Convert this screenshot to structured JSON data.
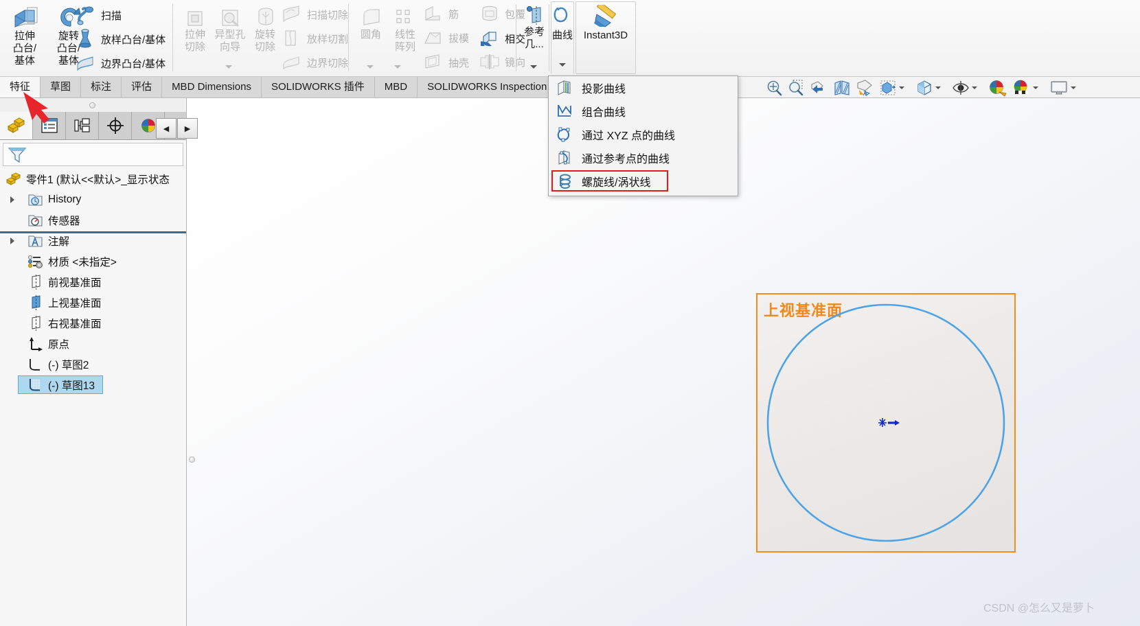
{
  "app": {
    "name": "SOLIDWORKS",
    "accent_orange": "#f2871a",
    "accent_blue": "#4da3e8",
    "highlight_red": "#e8181c",
    "selection_blue": "#add8f0"
  },
  "ribbon": {
    "groups": [
      {
        "id": "boss-base",
        "big_buttons": [
          {
            "name": "extrude-boss-base",
            "label_lines": [
              "拉伸",
              "凸台/",
              "基体"
            ],
            "icon": "extrude-boss-icon",
            "disabled": false
          },
          {
            "name": "revolve-boss-base",
            "label_lines": [
              "旋转",
              "凸台/",
              "基体"
            ],
            "icon": "revolve-boss-icon",
            "disabled": false
          }
        ],
        "row_buttons": [
          {
            "name": "swept-boss-base",
            "label": "扫描",
            "icon": "sweep-icon",
            "disabled": false
          },
          {
            "name": "lofted-boss-base",
            "label": "放样凸台/基体",
            "icon": "loft-icon",
            "disabled": false
          },
          {
            "name": "boundary-boss-base",
            "label": "边界凸台/基体",
            "icon": "boundary-icon",
            "disabled": false
          }
        ]
      },
      {
        "id": "cut",
        "big_buttons": [
          {
            "name": "extruded-cut",
            "label_lines": [
              "拉伸",
              "切除"
            ],
            "icon": "extrude-cut-icon",
            "disabled": true,
            "has_caret": true
          },
          {
            "name": "hole-wizard",
            "label_lines": [
              "异型孔",
              "向导"
            ],
            "icon": "hole-wizard-icon",
            "disabled": true
          },
          {
            "name": "revolved-cut",
            "label_lines": [
              "旋转",
              "切除"
            ],
            "icon": "revolve-cut-icon",
            "disabled": true
          }
        ],
        "row_buttons": [
          {
            "name": "swept-cut",
            "label": "扫描切除",
            "icon": "sweep-cut-icon",
            "disabled": true
          },
          {
            "name": "lofted-cut",
            "label": "放样切割",
            "icon": "loft-cut-icon",
            "disabled": true
          },
          {
            "name": "boundary-cut",
            "label": "边界切除",
            "icon": "boundary-cut-icon",
            "disabled": true
          }
        ]
      },
      {
        "id": "features",
        "big_buttons": [
          {
            "name": "fillet",
            "label_lines": [
              "圆角"
            ],
            "icon": "fillet-icon",
            "disabled": true,
            "has_caret": true
          },
          {
            "name": "linear-pattern",
            "label_lines": [
              "线性",
              "阵列"
            ],
            "icon": "linear-pattern-icon",
            "disabled": true,
            "has_caret": true
          }
        ],
        "row_buttons": [
          {
            "name": "rib",
            "label": "筋",
            "icon": "rib-icon",
            "disabled": true
          },
          {
            "name": "draft",
            "label": "拔模",
            "icon": "draft-icon",
            "disabled": true
          },
          {
            "name": "shell",
            "label": "抽壳",
            "icon": "shell-icon",
            "disabled": true
          },
          {
            "name": "wrap",
            "label": "包覆",
            "icon": "wrap-icon",
            "disabled": true
          },
          {
            "name": "intersect",
            "label": "相交",
            "icon": "intersect-icon",
            "disabled": false
          },
          {
            "name": "mirror",
            "label": "镜向",
            "icon": "mirror-icon",
            "disabled": true
          }
        ]
      },
      {
        "id": "reference",
        "big_buttons": [
          {
            "name": "reference-geometry",
            "label_lines": [
              "参考",
              "几..."
            ],
            "icon": "reference-geometry-icon",
            "disabled": false,
            "has_caret": true
          }
        ]
      },
      {
        "id": "curves",
        "big_buttons": [
          {
            "name": "curves",
            "label_lines": [
              "曲线"
            ],
            "icon": "curves-icon",
            "disabled": false,
            "has_caret": true,
            "active": true
          }
        ]
      },
      {
        "id": "instant3d",
        "buttons": [
          {
            "name": "instant3d",
            "label": "Instant3D",
            "icon": "instant3d-icon",
            "disabled": false
          }
        ]
      }
    ]
  },
  "tabs": {
    "items": [
      {
        "name": "tab-features",
        "label": "特征",
        "active": true
      },
      {
        "name": "tab-sketch",
        "label": "草图",
        "active": false
      },
      {
        "name": "tab-markup",
        "label": "标注",
        "active": false
      },
      {
        "name": "tab-evaluate",
        "label": "评估",
        "active": false
      },
      {
        "name": "tab-mbd-dimensions",
        "label": "MBD Dimensions",
        "active": false
      },
      {
        "name": "tab-solidworks-addins",
        "label": "SOLIDWORKS 插件",
        "active": false
      },
      {
        "name": "tab-mbd",
        "label": "MBD",
        "active": false
      },
      {
        "name": "tab-solidworks-inspection",
        "label": "SOLIDWORKS Inspection",
        "active": false
      }
    ]
  },
  "curves_menu": {
    "items": [
      {
        "name": "menu-item-projected-curve",
        "label": "投影曲线",
        "icon": "projected-curve-icon",
        "highlighted": false
      },
      {
        "name": "menu-item-composite-curve",
        "label": "组合曲线",
        "icon": "composite-curve-icon",
        "highlighted": false
      },
      {
        "name": "menu-item-curve-through-xyz",
        "label": "通过 XYZ 点的曲线",
        "icon": "curve-xyz-icon",
        "highlighted": false
      },
      {
        "name": "menu-item-curve-through-reference-points",
        "label": "通过参考点的曲线",
        "icon": "curve-ref-points-icon",
        "highlighted": false
      },
      {
        "name": "menu-item-helix-spiral",
        "label": "螺旋线/涡状线",
        "icon": "helix-spiral-icon",
        "highlighted": true
      }
    ]
  },
  "panel": {
    "tabs": [
      {
        "name": "pm-tab-feature-manager",
        "icon": "feature-manager-icon",
        "selected": true
      },
      {
        "name": "pm-tab-property-manager",
        "icon": "property-manager-icon",
        "selected": false
      },
      {
        "name": "pm-tab-configuration-manager",
        "icon": "configuration-manager-icon",
        "selected": false
      },
      {
        "name": "pm-tab-dimxpert-manager",
        "icon": "dimxpert-manager-icon",
        "selected": false
      },
      {
        "name": "pm-tab-display-manager",
        "icon": "display-manager-icon",
        "selected": false
      }
    ],
    "nav_prev": "◀",
    "nav_next": "▶",
    "filter_icon": "filter-icon"
  },
  "tree": {
    "root": {
      "name": "tree-root",
      "label": "零件1  (默认<<默认>_显示状态",
      "icon": "part-icon"
    },
    "items": [
      {
        "name": "tree-item-history",
        "label": "History",
        "icon": "history-folder-icon",
        "twisty": true,
        "indent": 40,
        "selected": false
      },
      {
        "name": "tree-item-sensors",
        "label": "传感器",
        "icon": "sensors-folder-icon",
        "twisty": false,
        "indent": 40,
        "selected": false
      },
      {
        "name": "tree-item-annotations",
        "label": "注解",
        "icon": "annotations-folder-icon",
        "twisty": true,
        "indent": 40,
        "selected": false
      },
      {
        "name": "tree-item-material",
        "label": "材质 <未指定>",
        "icon": "material-icon",
        "twisty": false,
        "indent": 40,
        "selected": false
      },
      {
        "name": "tree-item-front-plane",
        "label": "前视基准面",
        "icon": "plane-icon",
        "twisty": false,
        "indent": 40,
        "selected": false
      },
      {
        "name": "tree-item-top-plane",
        "label": "上视基准面",
        "icon": "plane-highlight-icon",
        "twisty": false,
        "indent": 40,
        "selected": false
      },
      {
        "name": "tree-item-right-plane",
        "label": "右视基准面",
        "icon": "plane-icon",
        "twisty": false,
        "indent": 40,
        "selected": false
      },
      {
        "name": "tree-item-origin",
        "label": "原点",
        "icon": "origin-icon",
        "twisty": false,
        "indent": 40,
        "selected": false
      },
      {
        "name": "tree-item-sketch2",
        "label": "(-) 草图2",
        "icon": "sketch-icon",
        "twisty": false,
        "indent": 40,
        "selected": false
      },
      {
        "name": "tree-item-sketch13",
        "label": "(-) 草图13",
        "icon": "sketch-active-icon",
        "twisty": false,
        "indent": 40,
        "selected": true
      }
    ]
  },
  "view_toolbar": {
    "items": [
      {
        "name": "zoom-to-fit-button",
        "icon": "zoom-to-fit-icon",
        "caret": false
      },
      {
        "name": "zoom-to-area-button",
        "icon": "zoom-to-area-icon",
        "caret": false
      },
      {
        "name": "previous-view-button",
        "icon": "previous-view-icon",
        "caret": false
      },
      {
        "name": "section-view-button",
        "icon": "section-view-icon",
        "caret": false
      },
      {
        "name": "view-orientation-button",
        "icon": "view-orientation-icon",
        "caret": false
      },
      {
        "name": "display-style-button",
        "icon": "display-style-icon",
        "caret": true
      },
      {
        "name": "apply-scene-button",
        "icon": "apply-scene-icon",
        "caret": true
      },
      {
        "name": "hide-show-items-button",
        "icon": "hide-show-eye-icon",
        "caret": true
      },
      {
        "name": "edit-appearance-button",
        "icon": "edit-appearance-icon",
        "caret": false
      },
      {
        "name": "apply-scene-2-button",
        "icon": "scene-checker-icon",
        "caret": true
      },
      {
        "name": "view-settings-button",
        "icon": "monitor-icon",
        "caret": true
      }
    ]
  },
  "canvas": {
    "plane_label": "上视基准面",
    "sketch": {
      "type": "circle",
      "entity_name": "sketch-circle",
      "stroke_color": "#4da3e8",
      "center_marker": "origin-point-marker"
    },
    "watermark": "CSDN @怎么又是萝卜"
  },
  "annotation": {
    "arrow_name": "red-pointer-arrow",
    "arrow_color": "#e8252b"
  }
}
